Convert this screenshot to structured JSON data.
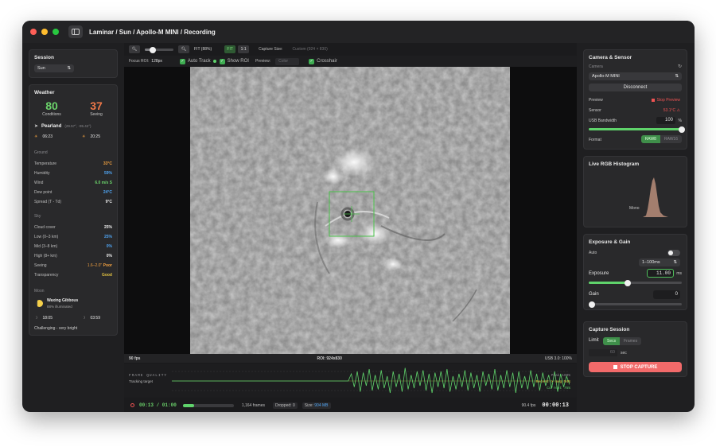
{
  "window": {
    "title": "Laminar / Sun / Apollo-M MINI / Recording"
  },
  "session": {
    "heading": "Session",
    "target": "Sun"
  },
  "weather": {
    "heading": "Weather",
    "conditions_value": "80",
    "conditions_label": "Conditions",
    "seeing_value": "37",
    "seeing_label": "Seeing",
    "location": "Pearland",
    "coords": "(29.57°, -95.42°)",
    "sunrise": "06:23",
    "sunset": "20:25",
    "ground_heading": "Ground",
    "ground": [
      {
        "label": "Temperature",
        "value": "33°C"
      },
      {
        "label": "Humidity",
        "value": "59%"
      },
      {
        "label": "Wind",
        "value": "6.0 m/s S"
      },
      {
        "label": "Dew point",
        "value": "24°C"
      },
      {
        "label": "Spread (T - Td)",
        "value": "9°C"
      }
    ],
    "sky_heading": "Sky",
    "sky": [
      {
        "label": "Cloud cover",
        "value": "25%"
      },
      {
        "label": "Low (0–3 km)",
        "value": "25%"
      },
      {
        "label": "Mid (3–8 km)",
        "value": "0%"
      },
      {
        "label": "High (8+ km)",
        "value": "0%"
      },
      {
        "label": "Seeing",
        "value": "1.6–2.0\"",
        "rating": "Poor"
      },
      {
        "label": "Transparency",
        "value": "Good"
      }
    ],
    "moon_heading": "Moon",
    "moon_phase": "Waxing Gibbous",
    "moon_illum": "88% illuminated",
    "moonrise": "18:05",
    "moonset": "03:59",
    "moon_note": "Challenging - very bright"
  },
  "toolbar": {
    "fit_label": "FIT (88%)",
    "fit_btn": "FIT",
    "one_btn": "1:1",
    "capture_size_label": "Capture Size:",
    "capture_size_value": "Custom (924 × 830)",
    "focus_roi_label": "Focus ROI:",
    "focus_roi_value": "128px",
    "auto_track": "Auto Track",
    "show_roi": "Show ROI",
    "preview_label": "Preview:",
    "preview_value": "Color",
    "crosshair": "Crosshair"
  },
  "status": {
    "fps": "90 fps",
    "roi": "ROI: 924x830",
    "usb": "USB 3.0: 100%"
  },
  "quality": {
    "title": "FRAME QUALITY",
    "subtitle": "Tracking target",
    "peak": "Peak 100%",
    "recent": "Recent > avg 54%",
    "current": "Current 75%",
    "trace": [
      0,
      0,
      0,
      0,
      0,
      0,
      0,
      0,
      0,
      0,
      0,
      0,
      0,
      0,
      0,
      0,
      0,
      0,
      0,
      0,
      0,
      0,
      0,
      0,
      0,
      0,
      0,
      0,
      0,
      0,
      0,
      0,
      0,
      0,
      0,
      0,
      0,
      0,
      0,
      0,
      0,
      0,
      0,
      0,
      0,
      0,
      0,
      0,
      0,
      0,
      0,
      0,
      0,
      0,
      0,
      0,
      0,
      0,
      0,
      0,
      6,
      -5,
      8,
      -9,
      7,
      -4,
      10,
      -8,
      5,
      -7,
      9,
      -6,
      4,
      -10,
      8,
      -5,
      6,
      -9,
      11,
      -7,
      5,
      -6,
      8,
      -4,
      9,
      -8,
      6,
      -10,
      7,
      -5,
      8,
      -6,
      10,
      -9,
      4,
      -7,
      6,
      -5,
      9,
      -8,
      7,
      -6,
      5,
      -9,
      8,
      -4,
      6,
      -7,
      10,
      -8,
      5,
      -6,
      9,
      -5,
      7,
      -10,
      8,
      -6,
      4,
      -7,
      9,
      -5,
      6,
      -8,
      7,
      -4,
      5,
      -6,
      8,
      -9,
      6,
      -5,
      4,
      -3
    ]
  },
  "recording": {
    "elapsed": "00:13 / 01:00",
    "progress": 0.22,
    "frames": "1,164 frames",
    "dropped_label": "Dropped:",
    "dropped": "0",
    "size_label": "Size:",
    "size": "904 MB",
    "fps": "90.4 fps",
    "timer": "00:00:13"
  },
  "camera": {
    "heading": "Camera & Sensor",
    "camera_label": "Camera",
    "camera_value": "Apollo-M MINI",
    "disconnect": "Disconnect",
    "preview_label": "Preview",
    "stop_preview": "Stop Preview",
    "sensor_label": "Sensor",
    "sensor_temp": "53.1°C",
    "usb_label": "USB Bandwidth",
    "usb_value": "100",
    "usb_unit": "%",
    "usb_level": 1.0,
    "format_label": "Format",
    "format_options": [
      "RAW8",
      "RAW16"
    ]
  },
  "histogram": {
    "heading": "Live RGB Histogram",
    "mode": "Mono"
  },
  "exposure": {
    "heading": "Exposure & Gain",
    "auto_label": "Auto",
    "range": "1–100ms",
    "exposure_label": "Exposure",
    "exposure_value": "11.00",
    "exposure_unit": "ms",
    "exposure_level": 0.42,
    "gain_label": "Gain",
    "gain_value": "0",
    "gain_level": 0.0
  },
  "capture": {
    "heading": "Capture Session",
    "limit_label": "Limit",
    "limit_options": [
      "Secs",
      "Frames"
    ],
    "secs_value": "60",
    "secs_unit": "sec",
    "stop_button": "STOP CAPTURE"
  },
  "colors": {
    "accent": "#5fd36b",
    "danger": "#ef6a6a",
    "bg": "#1f1f21"
  }
}
